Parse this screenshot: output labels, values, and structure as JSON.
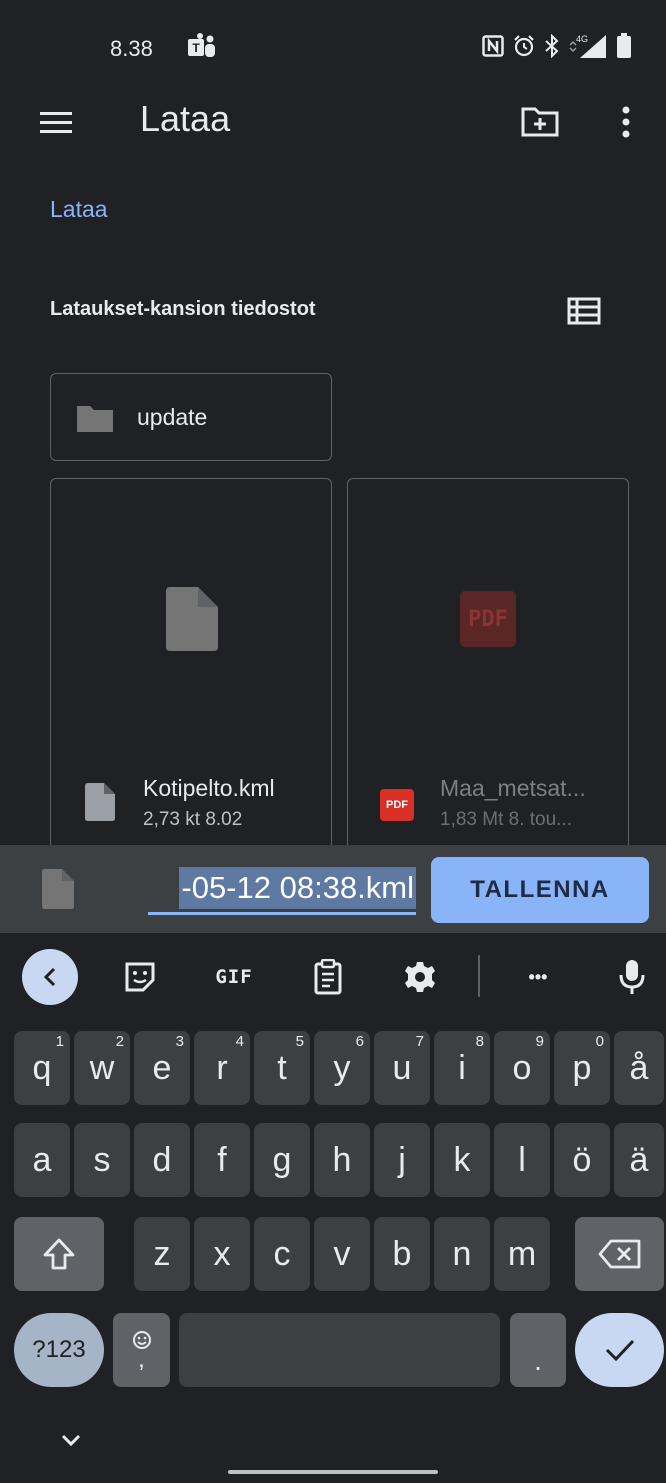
{
  "status_bar": {
    "time": "8.38",
    "icons": [
      "teams-icon",
      "nfc-icon",
      "alarm-icon",
      "bluetooth-icon",
      "4g-signal-icon",
      "battery-icon"
    ],
    "network_label": "4G"
  },
  "app_bar": {
    "title": "Lataa",
    "icons": [
      "menu-icon",
      "new-folder-icon",
      "more-options-icon"
    ]
  },
  "breadcrumb": "Lataa",
  "section": {
    "title": "Lataukset-kansion tiedostot",
    "view_icon": "list-view-icon"
  },
  "folders": [
    {
      "name": "update"
    }
  ],
  "files": [
    {
      "name": "Kotipelto.kml",
      "meta": "2,73 kt 8.02",
      "type": "file"
    },
    {
      "name": "Maa_metsat...",
      "meta": "1,83 Mt 8. tou...",
      "type": "pdf"
    }
  ],
  "pdf_label": "PDF",
  "save_bar": {
    "filename": "-05-12 08:38.kml",
    "save_label": "TALLENNA"
  },
  "keyboard": {
    "toolbar": {
      "gif_label": "GIF",
      "more_label": "•••"
    },
    "row1": [
      {
        "key": "q",
        "hint": "1"
      },
      {
        "key": "w",
        "hint": "2"
      },
      {
        "key": "e",
        "hint": "3"
      },
      {
        "key": "r",
        "hint": "4"
      },
      {
        "key": "t",
        "hint": "5"
      },
      {
        "key": "y",
        "hint": "6"
      },
      {
        "key": "u",
        "hint": "7"
      },
      {
        "key": "i",
        "hint": "8"
      },
      {
        "key": "o",
        "hint": "9"
      },
      {
        "key": "p",
        "hint": "0"
      },
      {
        "key": "å",
        "hint": ""
      }
    ],
    "row2": [
      "a",
      "s",
      "d",
      "f",
      "g",
      "h",
      "j",
      "k",
      "l",
      "ö",
      "ä"
    ],
    "row3": [
      "z",
      "x",
      "c",
      "v",
      "b",
      "n",
      "m"
    ],
    "symbols_label": "?123",
    "comma_label": ",",
    "period_label": "."
  },
  "colors": {
    "background": "#202124",
    "accent": "#8ab4f8",
    "surface": "#3c4043",
    "pdf_red": "#d93025"
  }
}
